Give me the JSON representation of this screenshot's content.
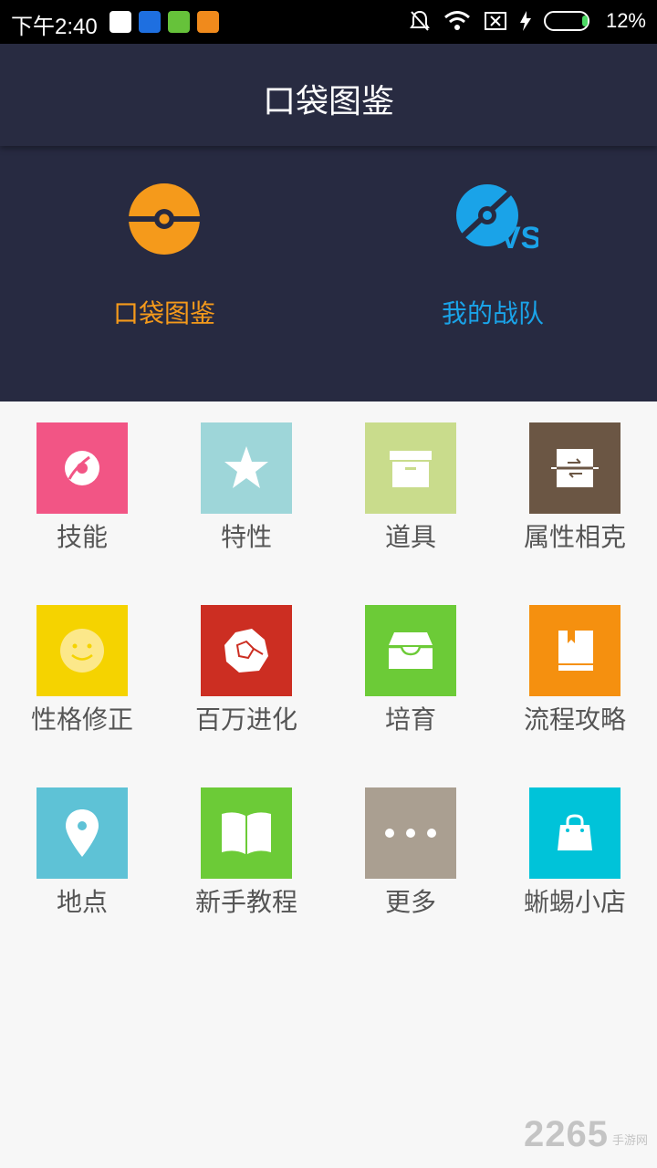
{
  "status_bar": {
    "time": "下午2:40",
    "battery": "12%"
  },
  "header": {
    "title": "口袋图鉴"
  },
  "hero": {
    "items": [
      {
        "label": "口袋图鉴",
        "icon": "pokeball-icon",
        "color": "#f59a1b"
      },
      {
        "label": "我的战队",
        "icon": "pokeball-vs-icon",
        "color": "#1aa3e8"
      }
    ]
  },
  "menu": {
    "items": [
      {
        "label": "技能",
        "icon": "disc-icon",
        "color": "#f25585"
      },
      {
        "label": "特性",
        "icon": "star-icon",
        "color": "#9ed6d9"
      },
      {
        "label": "道具",
        "icon": "box-icon",
        "color": "#c9dc8c"
      },
      {
        "label": "属性相克",
        "icon": "swap-icon",
        "color": "#6b5644"
      },
      {
        "label": "性格修正",
        "icon": "smiley-icon",
        "color": "#f5d300"
      },
      {
        "label": "百万进化",
        "icon": "rock-icon",
        "color": "#cc2e22"
      },
      {
        "label": "培育",
        "icon": "inbox-icon",
        "color": "#6ccb37"
      },
      {
        "label": "流程攻略",
        "icon": "book-icon",
        "color": "#f5900f"
      },
      {
        "label": "地点",
        "icon": "map-pin-icon",
        "color": "#5ec2d6"
      },
      {
        "label": "新手教程",
        "icon": "open-book-icon",
        "color": "#6ccb37"
      },
      {
        "label": "更多",
        "icon": "more-icon",
        "color": "#aa9f91"
      },
      {
        "label": "蜥蜴小店",
        "icon": "shopping-bag-icon",
        "color": "#00c3d9"
      }
    ]
  },
  "watermark": {
    "number": "2265",
    "site": "手游网"
  }
}
